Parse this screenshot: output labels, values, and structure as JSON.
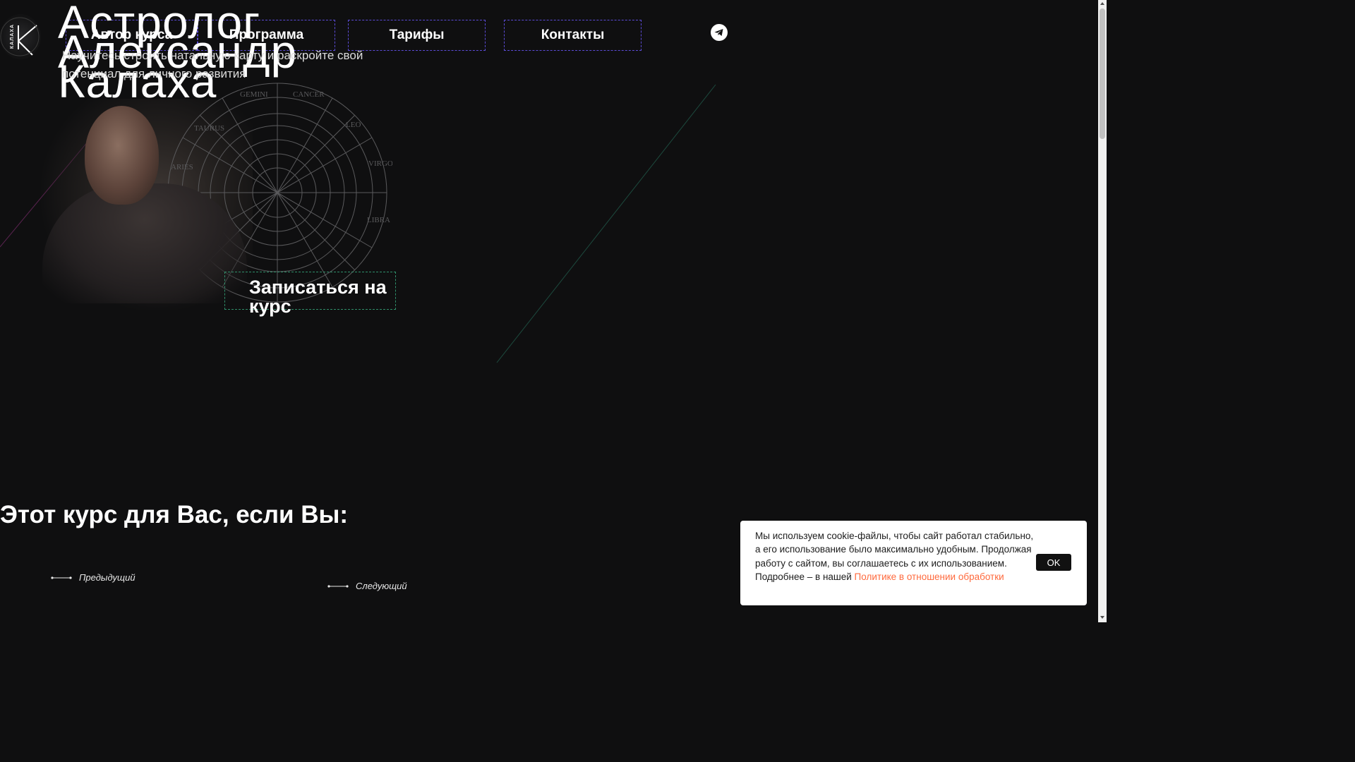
{
  "logo": {
    "text": "КАЛАХА"
  },
  "nav": {
    "items": [
      "Автор курса",
      "Программа",
      "Тарифы",
      "Контакты"
    ]
  },
  "hero": {
    "title": "Астролог Александр Калаха",
    "subtitle": "Научитесь строить натальную карту и раскройте свой потенциал для личного развития",
    "cta": "Записаться на курс",
    "zodiac_labels": [
      "GEMINI",
      "CANCER",
      "TAURUS",
      "LEO",
      "ARIES",
      "VIRGO",
      "LIBRA"
    ]
  },
  "section": {
    "title": "Этот курс для Вас, если Вы:"
  },
  "slider": {
    "prev": "Предыдущий",
    "next": "Следующий"
  },
  "cookie": {
    "text": "Мы используем cookie-файлы, чтобы сайт работал стабильно, а его использование было максимально удобным. Продолжая работу с сайтом, вы соглашаетесь с их использованием. Подробнее – в нашей ",
    "link": "Политике в отношении обработки",
    "ok": "OK"
  },
  "colors": {
    "background": "#0f0f10",
    "nav_border": "#5b4bd6",
    "cta_border": "#2f8f6a",
    "cookie_link": "#ff6a3d"
  },
  "icons": [
    "logo-icon",
    "telegram-icon",
    "arrow-left-icon"
  ]
}
